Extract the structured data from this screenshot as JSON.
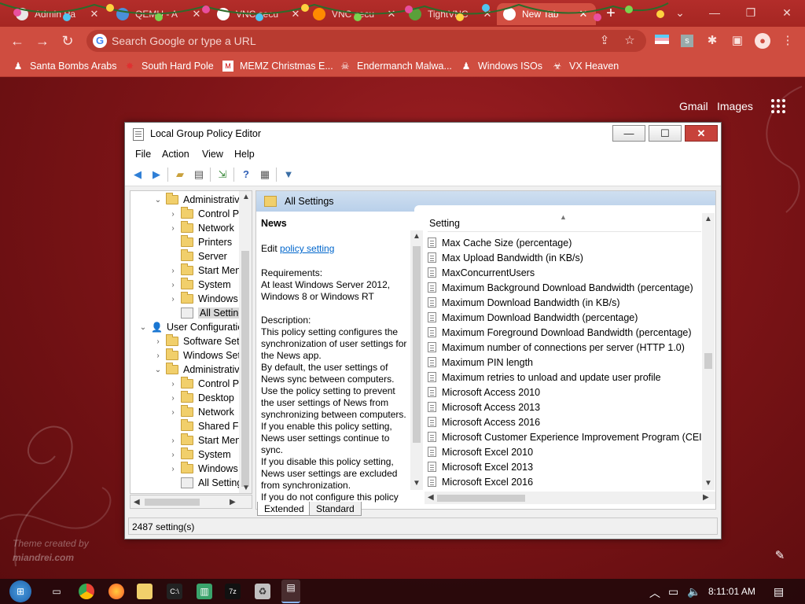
{
  "browser": {
    "tabs": [
      {
        "title": "Admin Pa",
        "favicon": "admin-icon",
        "color": "#e8e8e8",
        "active": false
      },
      {
        "title": "QEMU - A",
        "favicon": "qemu-icon",
        "color": "#4a90d9",
        "active": false
      },
      {
        "title": "VNC secu",
        "favicon": "chrome-icon",
        "color": "#ffffff",
        "active": false
      },
      {
        "title": "VNC secu",
        "favicon": "vnc-icon",
        "color": "#ff8a00",
        "active": false
      },
      {
        "title": "TightVNC",
        "favicon": "tightvnc-icon",
        "color": "#5aa03a",
        "active": false
      },
      {
        "title": "New Tab",
        "favicon": "chrome-icon",
        "color": "#ffffff",
        "active": true
      }
    ],
    "omnibox_placeholder": "Search Google or type a URL",
    "bookmarks": [
      {
        "label": "Santa Bombs Arabs",
        "icon": "figure-icon"
      },
      {
        "label": "South Hard Pole",
        "icon": "maple-leaf-icon"
      },
      {
        "label": "MEMZ Christmas E...",
        "icon": "page-icon"
      },
      {
        "label": "Endermanch Malwa...",
        "icon": "skull-icon"
      },
      {
        "label": "Windows ISOs",
        "icon": "figure-icon"
      },
      {
        "label": "VX Heaven",
        "icon": "biohazard-icon"
      }
    ]
  },
  "ntp": {
    "gmail": "Gmail",
    "images": "Images",
    "credit_line1": "Theme created by",
    "credit_line2": "miandrei.com"
  },
  "gpedit": {
    "title": "Local Group Policy Editor",
    "menu": [
      "File",
      "Action",
      "View",
      "Help"
    ],
    "tree": [
      {
        "label": "Administrative",
        "expander": "open",
        "icon": "folder",
        "indent": 1
      },
      {
        "label": "Control Pa",
        "expander": "closed",
        "icon": "folder",
        "indent": 2
      },
      {
        "label": "Network",
        "expander": "closed",
        "icon": "folder",
        "indent": 2
      },
      {
        "label": "Printers",
        "expander": "",
        "icon": "folder",
        "indent": 2
      },
      {
        "label": "Server",
        "expander": "",
        "icon": "folder",
        "indent": 2
      },
      {
        "label": "Start Menu",
        "expander": "closed",
        "icon": "folder",
        "indent": 2
      },
      {
        "label": "System",
        "expander": "closed",
        "icon": "folder",
        "indent": 2
      },
      {
        "label": "Windows C",
        "expander": "closed",
        "icon": "folder",
        "indent": 2
      },
      {
        "label": "All Setting",
        "expander": "",
        "icon": "settings",
        "indent": 2,
        "selected": true
      },
      {
        "label": "User Configuration",
        "expander": "open",
        "icon": "user",
        "indent": 0
      },
      {
        "label": "Software Setti",
        "expander": "closed",
        "icon": "folder",
        "indent": 1
      },
      {
        "label": "Windows Sett",
        "expander": "closed",
        "icon": "folder",
        "indent": 1
      },
      {
        "label": "Administrative",
        "expander": "open",
        "icon": "folder",
        "indent": 1
      },
      {
        "label": "Control Pa",
        "expander": "closed",
        "icon": "folder",
        "indent": 2
      },
      {
        "label": "Desktop",
        "expander": "closed",
        "icon": "folder",
        "indent": 2
      },
      {
        "label": "Network",
        "expander": "closed",
        "icon": "folder",
        "indent": 2
      },
      {
        "label": "Shared Fol",
        "expander": "",
        "icon": "folder",
        "indent": 2
      },
      {
        "label": "Start Menu",
        "expander": "closed",
        "icon": "folder",
        "indent": 2
      },
      {
        "label": "System",
        "expander": "closed",
        "icon": "folder",
        "indent": 2
      },
      {
        "label": "Windows C",
        "expander": "closed",
        "icon": "folder",
        "indent": 2
      },
      {
        "label": "All Setting",
        "expander": "",
        "icon": "settings",
        "indent": 2
      }
    ],
    "header": "All Settings",
    "desc": {
      "title": "News",
      "edit_prefix": "Edit ",
      "edit_link": "policy setting",
      "req_label": "Requirements:",
      "req_text": "At least Windows Server 2012, Windows 8 or Windows RT",
      "desc_label": "Description:",
      "desc_text": "This policy setting configures the synchronization of user settings for the News app.",
      "p2": "By default, the user settings of News sync between computers. Use the policy setting to prevent the user settings of News from synchronizing between computers.",
      "p3": "If you enable this policy setting, News user settings continue to sync.",
      "p4": "If you disable this policy setting, News user settings are excluded from synchronization.",
      "p5": "If you do not configure this policy"
    },
    "list_header": "Setting",
    "settings": [
      "Max Cache Size (percentage)",
      "Max Upload Bandwidth (in KB/s)",
      "MaxConcurrentUsers",
      "Maximum Background Download Bandwidth (percentage)",
      "Maximum Download Bandwidth (in KB/s)",
      "Maximum Download Bandwidth (percentage)",
      "Maximum Foreground Download Bandwidth (percentage)",
      "Maximum number of connections per server (HTTP 1.0)",
      "Maximum PIN length",
      "Maximum retries to unload and update user profile",
      "Microsoft Access 2010",
      "Microsoft Access 2013",
      "Microsoft Access 2016",
      "Microsoft Customer Experience Improvement Program (CEIP)",
      "Microsoft Excel 2010",
      "Microsoft Excel 2013",
      "Microsoft Excel 2016"
    ],
    "tab_extended": "Extended",
    "tab_standard": "Standard",
    "status": "2487 setting(s)"
  },
  "taskbar": {
    "clock": "8:11:01 AM"
  }
}
